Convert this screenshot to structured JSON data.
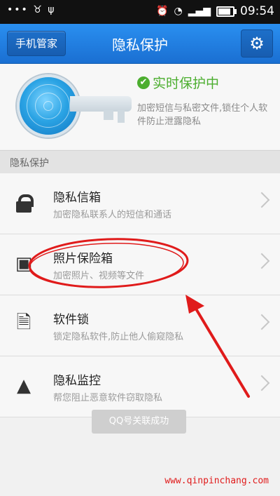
{
  "status_bar": {
    "left_icons": "••• ♉ ψ",
    "time": "09:54",
    "battery_level": 0.85
  },
  "header": {
    "back_label": "手机管家",
    "title": "隐私保护",
    "settings_icon": "gear-icon"
  },
  "status_card": {
    "status": "实时保护中",
    "description": "加密短信与私密文件,锁住个人软件防止泄露隐私"
  },
  "section": {
    "label": "隐私保护"
  },
  "list": [
    {
      "title": "隐私信箱",
      "subtitle": "加密隐私联系人的短信和通话",
      "icon": "lock-icon"
    },
    {
      "title": "照片保险箱",
      "subtitle": "加密照片、视频等文件",
      "icon": "photo-safe-icon"
    },
    {
      "title": "软件锁",
      "subtitle": "锁定隐私软件,防止他人偷窥隐私",
      "icon": "app-lock-icon"
    },
    {
      "title": "隐私监控",
      "subtitle": "帮您阻止恶意软件窃取隐私",
      "icon": "monitor-icon"
    }
  ],
  "toast": "QQ号关联成功",
  "watermark": "www.qinpinchang.com",
  "colors": {
    "header": "#1a6fd2",
    "status_green": "#4cae2f",
    "annotation_red": "#e01b1b"
  }
}
